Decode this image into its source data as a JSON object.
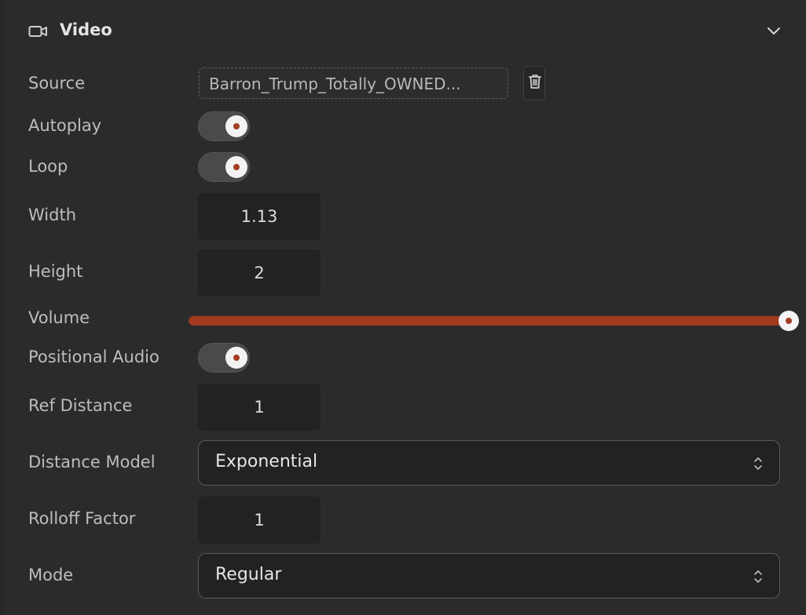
{
  "section": {
    "title": "Video",
    "icon": "video-camera-icon",
    "collapse_icon": "chevron-down-icon"
  },
  "fields": {
    "source": {
      "label": "Source",
      "value": "Barron_Trump_Totally_OWNED..."
    },
    "autoplay": {
      "label": "Autoplay",
      "checked": true
    },
    "loop": {
      "label": "Loop",
      "checked": true
    },
    "width": {
      "label": "Width",
      "value": "1.13"
    },
    "height": {
      "label": "Height",
      "value": "2"
    },
    "volume": {
      "label": "Volume",
      "level": 1.0
    },
    "positional_audio": {
      "label": "Positional Audio",
      "checked": true
    },
    "ref_distance": {
      "label": "Ref Distance",
      "value": "1"
    },
    "distance_model": {
      "label": "Distance Model",
      "value": "Exponential"
    },
    "rolloff_factor": {
      "label": "Rolloff Factor",
      "value": "1"
    },
    "mode": {
      "label": "Mode",
      "value": "Regular"
    }
  },
  "colors": {
    "accent": "#a0391e",
    "background": "#2b2b2c",
    "input_bg": "#222223"
  }
}
